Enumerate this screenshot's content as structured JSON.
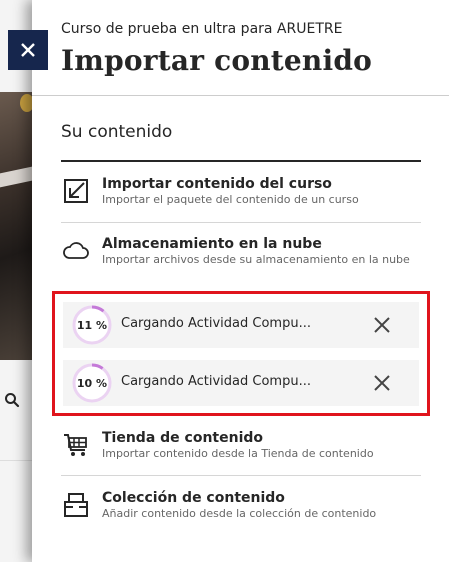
{
  "panel": {
    "course_name": "Curso de prueba en ultra para ARUETRE",
    "title": "Importar contenido",
    "section_title": "Su contenido"
  },
  "items": [
    {
      "label": "Importar contenido del curso",
      "description": "Importar el paquete del contenido de un curso",
      "icon": "import-icon"
    },
    {
      "label": "Almacenamiento en la nube",
      "description": "Importar archivos desde su almacenamiento en la nube",
      "icon": "cloud-icon"
    },
    {
      "label": "Tienda de contenido",
      "description": "Importar contenido desde la Tienda de contenido",
      "icon": "cart-icon"
    },
    {
      "label": "Colección de contenido",
      "description": "Añadir contenido desde la colección de contenido",
      "icon": "collection-icon"
    }
  ],
  "loading": [
    {
      "percent_label": "11 %",
      "progress": 0.11,
      "text": "Cargando Actividad Compu..."
    },
    {
      "percent_label": "10 %",
      "progress": 0.1,
      "text": "Cargando Actividad Compu..."
    }
  ],
  "colors": {
    "close_button": "#16264d",
    "highlight_border": "#e0141c",
    "progress_arc": "#c47ad8",
    "progress_track": "#ebd3f2"
  }
}
